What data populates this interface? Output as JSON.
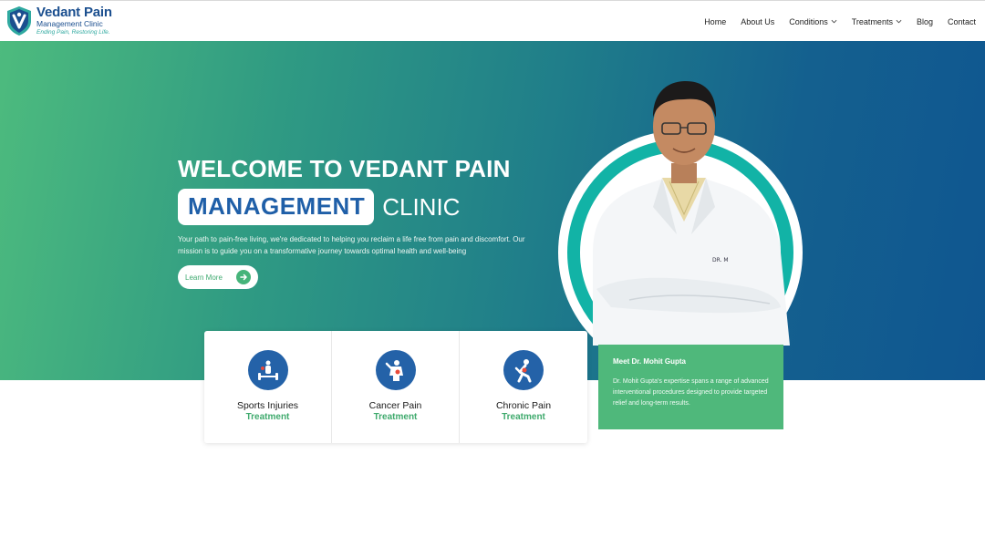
{
  "header": {
    "logo": {
      "title": "Vedant Pain",
      "subtitle": "Management Clinic",
      "tagline": "Ending Pain, Restoring Life."
    },
    "nav": [
      {
        "label": "Home",
        "has_dropdown": false
      },
      {
        "label": "About Us",
        "has_dropdown": false
      },
      {
        "label": "Conditions",
        "has_dropdown": true
      },
      {
        "label": "Treatments",
        "has_dropdown": true
      },
      {
        "label": "Blog",
        "has_dropdown": false
      },
      {
        "label": "Contact",
        "has_dropdown": false
      }
    ]
  },
  "hero": {
    "title_line1": "WELCOME TO VEDANT PAIN",
    "title_highlight": "MANAGEMENT",
    "title_rest": "CLINIC",
    "description": "Your path to pain-free living, we're dedicated to helping you reclaim a life free from pain and discomfort. Our mission is to guide you on a transformative journey towards optimal health and well-being",
    "cta_label": "Learn More",
    "gradient_colors": [
      "#4dbb7e",
      "#0f5690"
    ]
  },
  "cards": [
    {
      "title": "Sports Injuries",
      "subtitle": "Treatment",
      "icon": "sports-injury-icon"
    },
    {
      "title": "Cancer Pain",
      "subtitle": "Treatment",
      "icon": "cancer-pain-icon"
    },
    {
      "title": "Chronic Pain",
      "subtitle": "Treatment",
      "icon": "chronic-pain-icon"
    }
  ],
  "doctor": {
    "meet_title": "Meet Dr. Mohit Gupta",
    "meet_description": "Dr. Mohit Gupta's expertise spans a range of advanced interventional procedures designed to provide targeted relief and long-term results.",
    "coat_badge": "DR. M"
  },
  "colors": {
    "brand_blue": "#1f5fa8",
    "brand_green": "#3faa6d",
    "accent_teal": "#12b3a6"
  }
}
